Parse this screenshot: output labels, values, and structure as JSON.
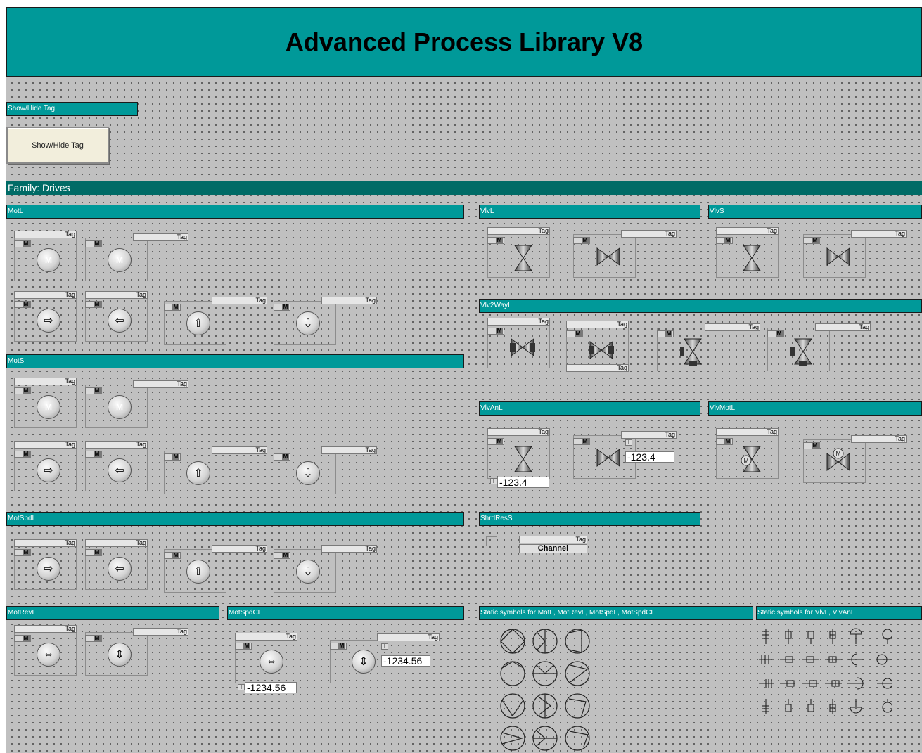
{
  "title": "Advanced Process Library V8",
  "show_hide": {
    "label": "Show/Hide Tag",
    "button": "Show/Hide Tag"
  },
  "family": "Family: Drives",
  "sections": {
    "motl": "MotL",
    "mots": "MotS",
    "motspdl": "MotSpdL",
    "motrevl": "MotRevL",
    "motspdcl": "MotSpdCL",
    "vlvl": "VlvL",
    "vlvs": "VlvS",
    "vlv2wayl": "Vlv2WayL",
    "vlvanl": "VlvAnL",
    "vlvmotl": "VlvMotL",
    "shrdress": "ShrdResS",
    "static_mot": "Static symbols for MotL, MotRevL, MotSpdL, MotSpdCL",
    "static_vlv": "Static symbols for VlvL, VlvAnL"
  },
  "tag_text": "Tag",
  "manual_mark": "M",
  "motor_mark": "M",
  "values": {
    "vlvanl_1": "-123.4",
    "vlvanl_2": "-123.4",
    "motspdcl_1": "-1234.56",
    "motspdcl_2": "-1234.56"
  },
  "channel": "Channel",
  "colors": {
    "header": "#009999",
    "family_bar": "#006b66",
    "canvas": "#c0c0c0"
  }
}
